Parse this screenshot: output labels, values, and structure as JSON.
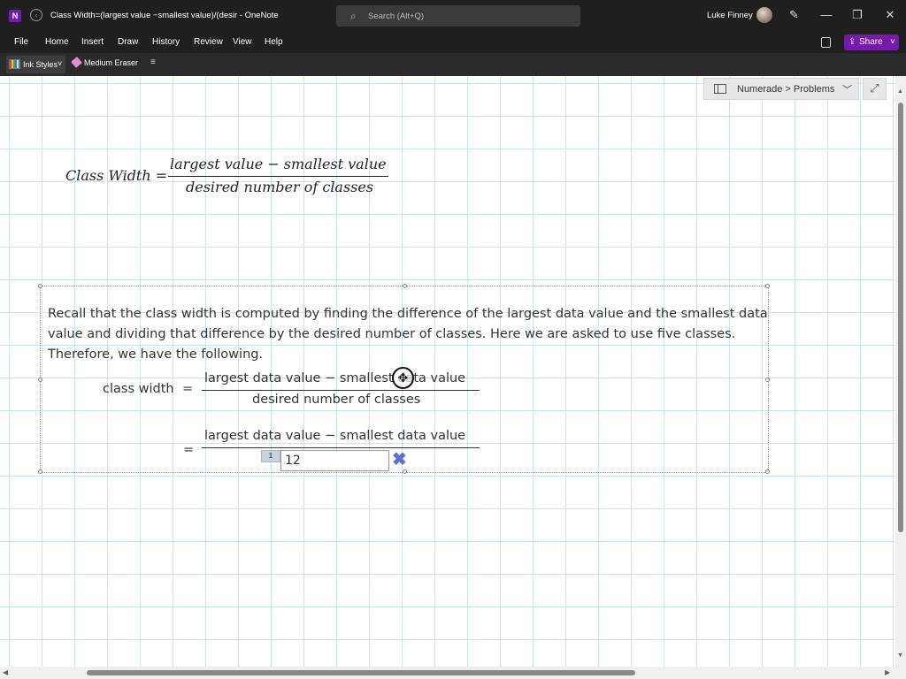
{
  "window": {
    "title": "Class Width=(largest value −smallest value)/(desir  -  OneNote",
    "search_placeholder": "Search (Alt+Q)",
    "user_name": "Luke Finney"
  },
  "menu": {
    "items": [
      "File",
      "Home",
      "Insert",
      "Draw",
      "History",
      "Review",
      "View",
      "Help"
    ],
    "share_label": "Share"
  },
  "toolbar": {
    "ink_styles_label": "Ink Styles",
    "eraser_label": "Medium Eraser"
  },
  "navigation": {
    "breadcrumb": "Numerade > Problems"
  },
  "formula": {
    "lhs": "Class Width =",
    "numerator": "largest value  − smallest value",
    "denominator": "desired number of classes"
  },
  "content": {
    "paragraph": "Recall that the class width is computed by finding the difference of the largest data value and the smallest data value and dividing that difference by the desired number of classes. Here we are asked to use five classes. Therefore, we have the following.",
    "class_width_label": "class width",
    "equals": "=",
    "eq1_numerator": "largest data value − smallest data value",
    "eq1_denominator": "desired number of classes",
    "eq2_numerator": "largest data value − smallest data value",
    "badge": "1",
    "answer_value": "12"
  }
}
